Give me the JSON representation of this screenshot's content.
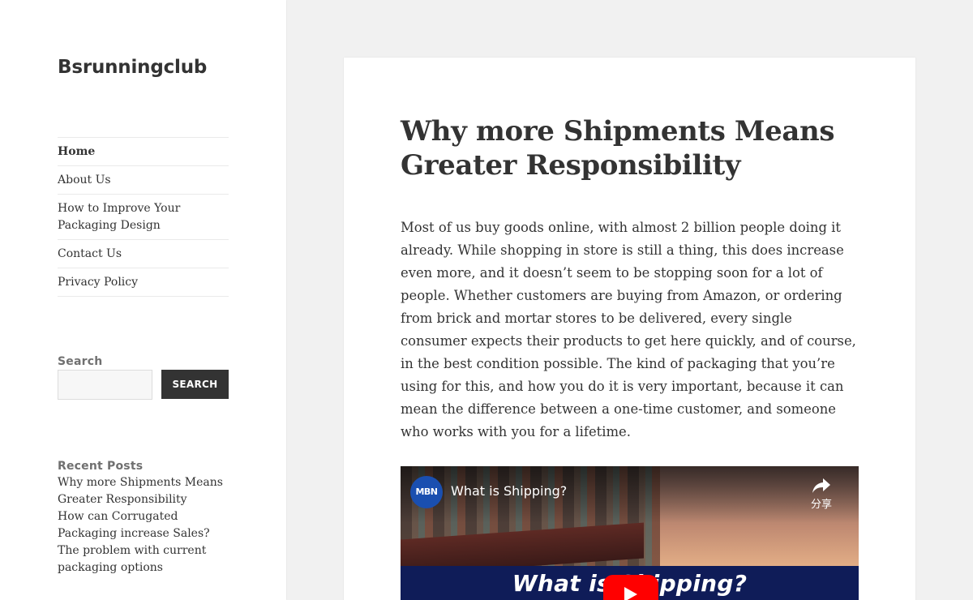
{
  "site": {
    "title": "Bsrunningclub"
  },
  "nav": {
    "items": [
      {
        "label": "Home",
        "current": true
      },
      {
        "label": "About Us"
      },
      {
        "label": "How to Improve Your Packaging Design"
      },
      {
        "label": "Contact Us"
      },
      {
        "label": "Privacy Policy"
      }
    ]
  },
  "search": {
    "title": "Search",
    "input_value": "",
    "button_label": "Search"
  },
  "recent": {
    "title": "Recent Posts",
    "items": [
      "Why more Shipments Means Greater Responsibility",
      "How can Corrugated Packaging increase Sales?",
      "The problem with current packaging options"
    ]
  },
  "post": {
    "title": "Why more Shipments Means Greater Responsibility",
    "body": "Most of us buy goods online, with almost 2 billion people doing it already. While shopping in store is still a thing, this does increase even more, and it doesn’t seem to be stopping soon for a lot of people. Whether customers are buying from Amazon, or ordering from brick and mortar stores to be delivered, every single consumer expects their products to get here quickly, and of course, in the best condition possible. The kind of packaging that you’re using for this, and how you do it is very important, because it can mean the difference between a one-time customer, and someone who works with you for a lifetime."
  },
  "video": {
    "channel_logo": "MBN",
    "title": "What is Shipping?",
    "share_label": "分享",
    "overlay_text": "What is Shipping?",
    "icons": {
      "share": "share-icon",
      "play": "play-icon"
    }
  },
  "colors": {
    "page_bg": "#f1f1f1",
    "text": "#333333",
    "widget_title": "#707070",
    "button_bg": "#333333",
    "youtube_red": "#ff0000"
  }
}
